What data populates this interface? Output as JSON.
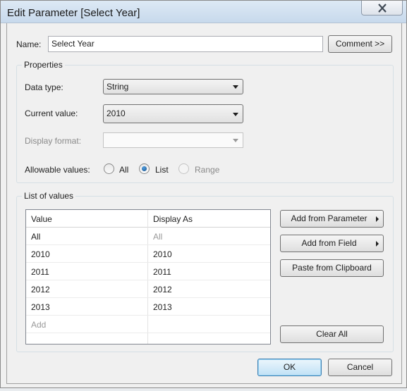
{
  "window": {
    "title": "Edit Parameter [Select Year]"
  },
  "name_field": {
    "label": "Name:",
    "value": "Select Year"
  },
  "comment_button": {
    "label": "Comment >>"
  },
  "properties": {
    "title": "Properties",
    "data_type": {
      "label": "Data type:",
      "value": "String"
    },
    "current_value": {
      "label": "Current value:",
      "value": "2010"
    },
    "display_format": {
      "label": "Display format:",
      "value": ""
    },
    "allowable_values": {
      "label": "Allowable values:",
      "options": [
        {
          "label": "All",
          "checked": false,
          "enabled": true
        },
        {
          "label": "List",
          "checked": true,
          "enabled": true
        },
        {
          "label": "Range",
          "checked": false,
          "enabled": false
        }
      ]
    }
  },
  "list_of_values": {
    "title": "List of values",
    "columns": [
      "Value",
      "Display As"
    ],
    "rows": [
      {
        "value": "All",
        "display": "All"
      },
      {
        "value": "2010",
        "display": "2010"
      },
      {
        "value": "2011",
        "display": "2011"
      },
      {
        "value": "2012",
        "display": "2012"
      },
      {
        "value": "2013",
        "display": "2013"
      },
      {
        "value": "Add",
        "display": ""
      }
    ]
  },
  "side_buttons": {
    "add_from_parameter": "Add from Parameter",
    "add_from_field": "Add from Field",
    "paste_from_clipboard": "Paste from Clipboard",
    "clear_all": "Clear All"
  },
  "footer": {
    "ok": "OK",
    "cancel": "Cancel"
  },
  "colors": {
    "titlebar": "#c7d9ec",
    "dialog_bg": "#f0f0f0",
    "radio_selected": "#1a4f86",
    "disabled_text": "#8a8a8a"
  }
}
